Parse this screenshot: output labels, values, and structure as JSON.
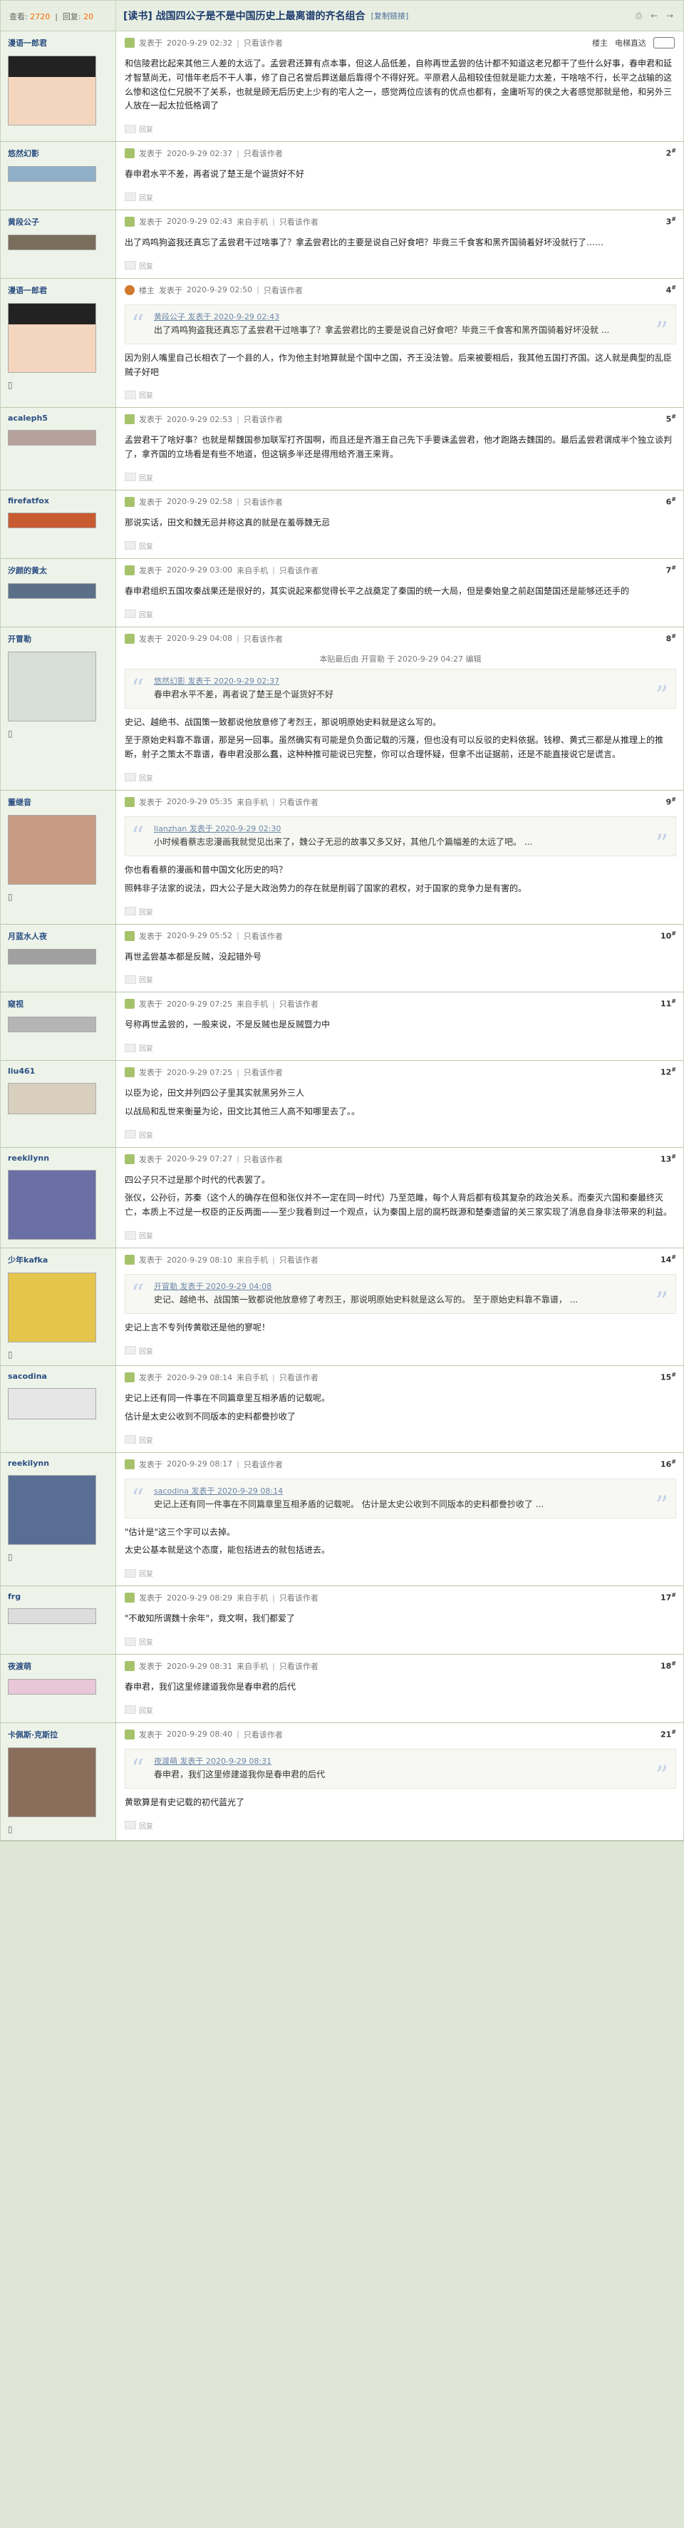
{
  "topbar": {
    "views_label": "查看:",
    "views": "2720",
    "replies_label": "回复:",
    "replies": "20",
    "title": "[读书] 战国四公子是不是中国历史上最离谱的齐名组合",
    "copy_link": "[复制链接]"
  },
  "first_post_tools": {
    "author_only": "楼主",
    "e_fan_mode": "电梯直达"
  },
  "common": {
    "posted_prefix": "发表于",
    "author_only": "只看该作者",
    "reply_label": "回复"
  },
  "posts": [
    {
      "user": "漫语一郎君",
      "time": "2020-9-29 02:32",
      "floor": "",
      "paragraphs": [
        "和信陵君比起来其他三人差的太远了。孟尝君还算有点本事，但这人品低差，自称再世孟尝的估计都不知道这老兄都干了些什么好事，春申君和延才智慧尚无，可惜年老后不干人事，修了自己名誉后葬送最后靠得个不得好死。平原君人品相较佳但就是能力太差，干啥啥不行，长平之战输的这么惨和这位仁兄脱不了关系，也就是顾无后历史上少有的宅人之一，感觉两位应该有的优点也都有，金庸听写的侠之大者感觉那就是他，和另外三人放在一起太拉低格调了"
      ]
    },
    {
      "user": "悠然幻影",
      "time": "2020-9-29 02:37",
      "floor": "2",
      "paragraphs": [
        "春申君水平不差，再者说了楚王是个诞货好不好"
      ]
    },
    {
      "user": "黄段公子",
      "time": "2020-9-29 02:43",
      "from": "来自手机",
      "floor": "3",
      "paragraphs": [
        "出了鸡鸣狗盗我还真忘了孟尝君干过啥事了？拿孟尝君比的主要是说自己好食吧？毕竟三千食客和黑齐国骑着好坏没就行了……"
      ]
    },
    {
      "user": "漫语一郎君",
      "tag": "楼主",
      "time": "2020-9-29 02:50",
      "floor": "4",
      "quote_head": "黄段公子 发表于 2020-9-29 02:43",
      "quote": "出了鸡鸣狗盗我还真忘了孟尝君干过啥事了？拿孟尝君比的主要是说自己好食吧？毕竟三千食客和黑齐国骑着好坏没就 ...",
      "paragraphs": [
        "因为别人嘴里自己长相衣了一个县的人，作为他主封地算就是个国中之国，齐王没法管。后来被要相后，我其他五国打齐国。这人就是典型的乱臣贼子好吧"
      ]
    },
    {
      "user": "acaleph5",
      "time": "2020-9-29 02:53",
      "floor": "5",
      "paragraphs": [
        "孟尝君干了啥好事？也就是帮魏国参加联军打齐国啊，而且还是齐湣王自己先下手要诛孟尝君，他才跑路去魏国的。最后孟尝君谓成半个独立谈判了，拿齐国的立场看是有些不地道，但这锅多半还是得甩给齐湣王来背。"
      ]
    },
    {
      "user": "firefatfox",
      "time": "2020-9-29 02:58",
      "floor": "6",
      "paragraphs": [
        "那说实话，田文和魏无忌并称这真的就是在羞辱魏无忌"
      ]
    },
    {
      "user": "汐颜的黄太",
      "time": "2020-9-29 03:00",
      "from": "来自手机",
      "floor": "7",
      "paragraphs": [
        "春申君组织五国攻秦战果还是很好的，其实说起来都觉得长平之战奠定了秦国的统一大局，但是秦始皇之前赵国楚国还是能够还还手的"
      ]
    },
    {
      "user": "开冒勒",
      "time": "2020-9-29 04:08",
      "floor": "8",
      "edited": "本贴最后由 开冒勒 于 2020-9-29 04:27 编辑",
      "quote_head": "悠然幻影 发表于 2020-9-29 02:37",
      "quote": "春申君水平不差，再者说了楚王是个诞货好不好",
      "paragraphs": [
        "史记、越绝书、战国策一致都说他放意修了考烈王，那说明原始史料就是这么写的。",
        "至于原始史料靠不靠谱，那是另一回事。虽然确实有可能是负负面记载的污蔑，但也没有可以反驳的史料依据。钱穆、黄式三都是从推理上的推断，射子之策太不靠谱，春申君没那么蠢，这种种推可能说已完整，你可以合理怀疑，但拿不出证据前，还是不能直接说它是谎言。"
      ]
    },
    {
      "user": "董继音",
      "time": "2020-9-29 05:35",
      "from": "来自手机",
      "floor": "9",
      "quote_head": "lianzhan 发表于 2020-9-29 02:30",
      "quote": "小时候看蔡志忠漫画我就觉见出来了，魏公子无忌的故事又多又好，其他几个篇幅差的太远了吧。 ...",
      "paragraphs": [
        "你也看看蔡的漫画和普中国文化历史的吗？",
        "照韩非子法家的说法，四大公子是大政治势力的存在就是削弱了国家的君权，对于国家的竞争力是有害的。"
      ]
    },
    {
      "user": "月蓝水人夜",
      "time": "2020-9-29 05:52",
      "floor": "10",
      "paragraphs": [
        "再世孟尝基本都是反贼，没起错外号"
      ]
    },
    {
      "user": "窥视",
      "time": "2020-9-29 07:25",
      "from": "来自手机",
      "floor": "11",
      "paragraphs": [
        "号称再世孟尝的，一般来说，不是反贼也是反贼暨力中"
      ]
    },
    {
      "user": "liu461",
      "time": "2020-9-29 07:25",
      "floor": "12",
      "paragraphs": [
        "以臣为论，田文并列四公子里其实就黑另外三人",
        "以战局和乱世来衡量为论，田文比其他三人高不知哪里去了。。"
      ]
    },
    {
      "user": "reekilynn",
      "time": "2020-9-29 07:27",
      "floor": "13",
      "paragraphs": [
        "四公子只不过是那个时代的代表罢了。",
        "张仪，公孙衍，苏秦（这个人的确存在但和张仪并不一定在同一时代）乃至范雎，每个人背后都有极其复杂的政治关系。而秦灭六国和秦最终灭亡，本质上不过是一权臣的正反两面——至少我看到过一个观点，认为秦国上层的腐朽既源和楚秦遗留的关三家实现了消息自身非法带来的利益。"
      ]
    },
    {
      "user": "少年kafka",
      "time": "2020-9-29 08:10",
      "from": "来自手机",
      "floor": "14",
      "quote_head": "开冒勒 发表于 2020-9-29 04:08",
      "quote": "史记、越绝书、战国策一致都说他放意修了考烈王，那说明原始史料就是这么写的。 至于原始史料靠不靠谱， ...",
      "paragraphs": [
        "史记上言不专列传黄歇还是他的寥呢！"
      ]
    },
    {
      "user": "sacodina",
      "time": "2020-9-29 08:14",
      "from": "来自手机",
      "floor": "15",
      "paragraphs": [
        "史记上还有同一件事在不同篇章里互相矛盾的记载呢。",
        "估计是太史公收到不同版本的史料都誊抄收了"
      ]
    },
    {
      "user": "reekilynn",
      "time": "2020-9-29 08:17",
      "floor": "16",
      "quote_head": "sacodina 发表于 2020-9-29 08:14",
      "quote": "史记上还有同一件事在不同篇章里互相矛盾的记载呢。 估计是太史公收到不同版本的史料都誊抄收了 ...",
      "paragraphs": [
        "\"估计是\"这三个字可以去掉。",
        "太史公基本就是这个态度，能包括进去的就包括进去。"
      ]
    },
    {
      "user": "frg",
      "time": "2020-9-29 08:29",
      "from": "来自手机",
      "floor": "17",
      "paragraphs": [
        "\"不敢知所谓魏十余年\"，竟文啊，我们都爱了"
      ]
    },
    {
      "user": "夜渡萌",
      "time": "2020-9-29 08:31",
      "from": "来自手机",
      "floor": "18",
      "paragraphs": [
        "春申君，我们这里修建道我你是春申君的后代"
      ]
    },
    {
      "user": "卡佩斯·克斯拉",
      "time": "2020-9-29 08:40",
      "floor": "21",
      "quote_head": "夜渡萌 发表于 2020-9-29 08:31",
      "quote": "春申君，我们这里修建道我你是春申君的后代",
      "paragraphs": [
        "黄歌算是有史记载的初代蓝光了"
      ]
    }
  ]
}
